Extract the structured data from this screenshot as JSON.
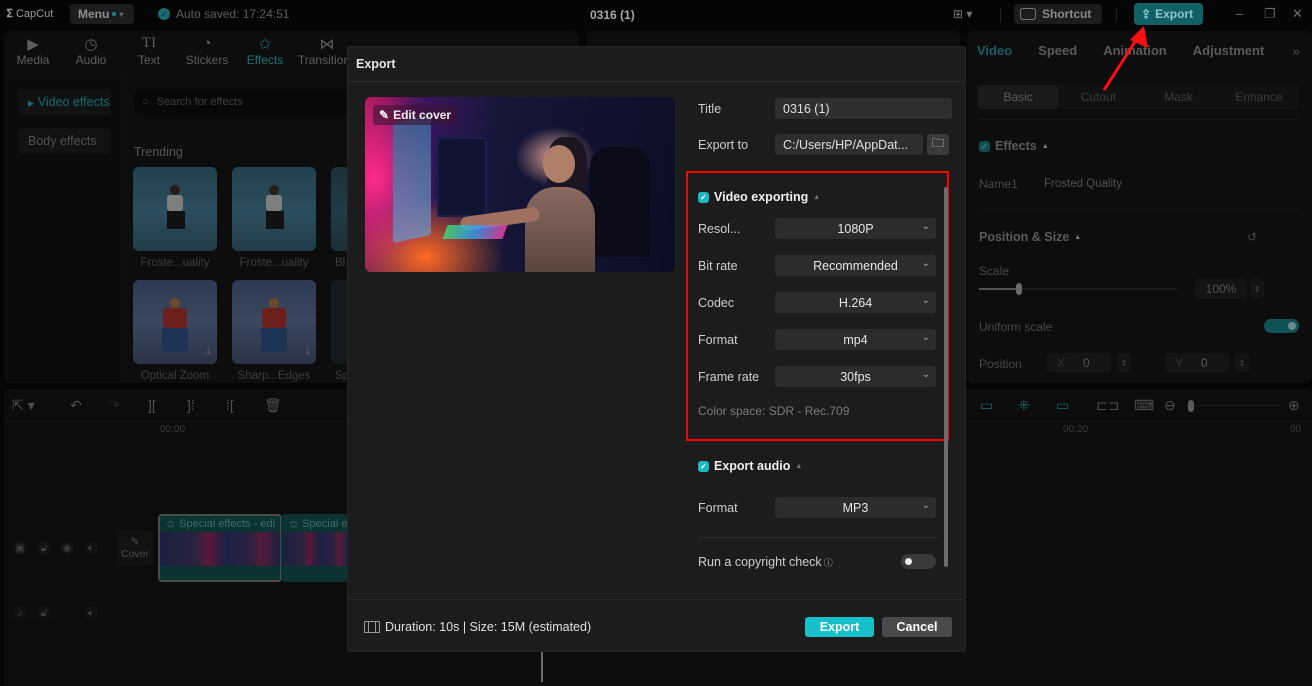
{
  "app": {
    "logo": "CapCut",
    "menu_label": "Menu",
    "autosave": "Auto saved: 17:24:51",
    "project_title": "0316 (1)",
    "shortcut_label": "Shortcut",
    "export_label": "Export"
  },
  "toolbar": {
    "tabs": [
      {
        "label": "Media",
        "icon": "media-icon"
      },
      {
        "label": "Audio",
        "icon": "audio-icon"
      },
      {
        "label": "Text",
        "icon": "text-icon"
      },
      {
        "label": "Stickers",
        "icon": "stickers-icon"
      },
      {
        "label": "Effects",
        "icon": "effects-icon",
        "active": true
      },
      {
        "label": "Transitions",
        "icon": "transitions-icon"
      }
    ]
  },
  "effects_panel": {
    "sidebar": [
      "Video effects",
      "Body effects"
    ],
    "search_placeholder": "Search for effects",
    "section": "Trending",
    "items": [
      "Froste...uality",
      "Froste...uality",
      "Bl",
      "Optical Zoom",
      "Sharp...Edges",
      "Sp"
    ]
  },
  "inspector": {
    "tabs": [
      "Video",
      "Speed",
      "Animation",
      "Adjustment"
    ],
    "more": "»",
    "subtabs": [
      "Basic",
      "Cutout",
      "Mask",
      "Enhance"
    ],
    "effects_section": "Effects",
    "name_label": "Name1",
    "name_value": "Frosted Quality",
    "position_size": "Position & Size",
    "scale_label": "Scale",
    "scale_value": "100%",
    "scale_fraction": 0.2,
    "uniform_scale": "Uniform scale",
    "uniform_scale_on": true,
    "position_label": "Position",
    "x_label": "X",
    "x_value": "0",
    "y_label": "Y",
    "y_value": "0"
  },
  "timeline": {
    "ruler": [
      "00:00",
      "00:20",
      "00"
    ],
    "cover_label": "Cover",
    "clips": [
      "Special effects - edi",
      "Special e"
    ]
  },
  "export_dialog": {
    "title": "Export",
    "edit_cover": "Edit cover",
    "title_label": "Title",
    "title_value": "0316 (1)",
    "export_to_label": "Export to",
    "export_to_value": "C:/Users/HP/AppDat...",
    "video_section": "Video exporting",
    "video_enabled": true,
    "fields": [
      {
        "label": "Resol...",
        "value": "1080P"
      },
      {
        "label": "Bit rate",
        "value": "Recommended"
      },
      {
        "label": "Codec",
        "value": "H.264"
      },
      {
        "label": "Format",
        "value": "mp4"
      },
      {
        "label": "Frame rate",
        "value": "30fps"
      }
    ],
    "color_space": "Color space: SDR - Rec.709",
    "audio_section": "Export audio",
    "audio_enabled": true,
    "audio_format_label": "Format",
    "audio_format_value": "MP3",
    "copyright_label": "Run a copyright check",
    "copyright_on": false,
    "duration": "Duration: 10s | Size: 15M (estimated)",
    "export_button": "Export",
    "cancel_button": "Cancel"
  },
  "colors": {
    "accent": "#17bfca",
    "highlight": "#ff0000"
  }
}
